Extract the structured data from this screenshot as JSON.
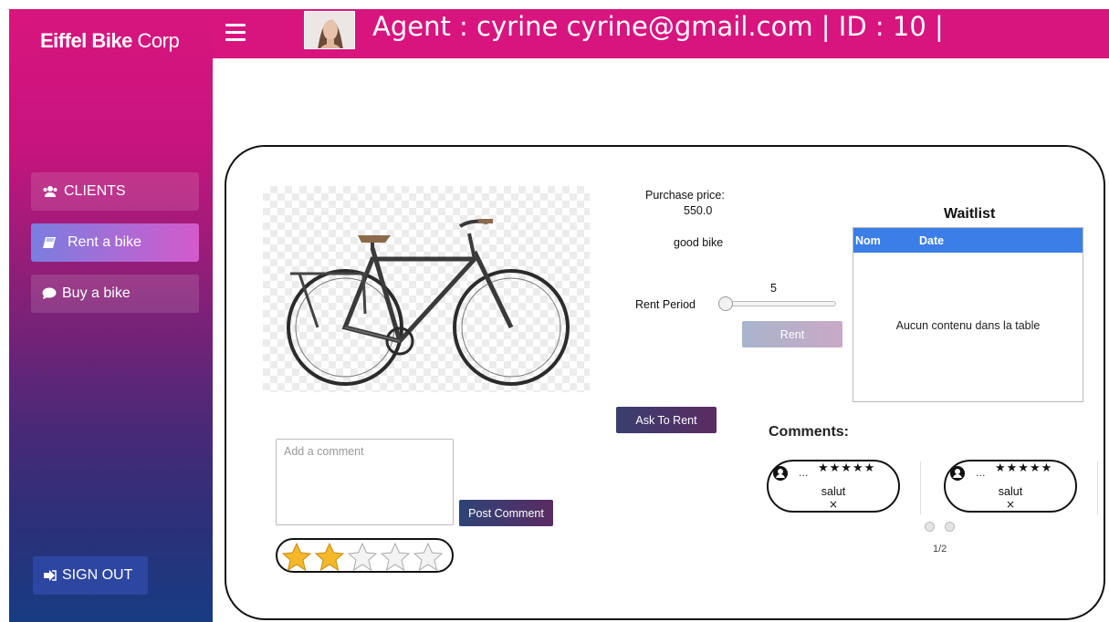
{
  "sidebar": {
    "brand": "Eiffel Bike",
    "brand_suffix": "Corp",
    "items": [
      {
        "label": "CLIENTS",
        "icon": "users-icon"
      },
      {
        "label": "Rent a bike",
        "icon": "book-icon"
      },
      {
        "label": "Buy a bike",
        "icon": "chat-icon"
      }
    ],
    "signout_label": "SIGN OUT"
  },
  "header": {
    "agent_text": "Agent : cyrine cyrine@gmail.com | ID : 10 |"
  },
  "product": {
    "purchase_label": "Purchase price:",
    "purchase_value": "550.0",
    "description": "good bike",
    "rent_period_label": "Rent Period",
    "rent_period_value": "5",
    "rent_period_level": 0.0,
    "rent_button": "Rent",
    "ask_button": "Ask To Rent"
  },
  "waitlist": {
    "title": "Waitlist",
    "columns": [
      "Nom",
      "Date"
    ],
    "empty_text": "Aucun contenu dans la table"
  },
  "comments": {
    "title": "Comments:",
    "items": [
      {
        "user": "...",
        "stars": 5,
        "text": "salut",
        "delete": "×"
      },
      {
        "user": "...",
        "stars": 5,
        "text": "salut",
        "delete": "×"
      }
    ],
    "page_indicator": "1/2"
  },
  "new_comment": {
    "placeholder": "Add a comment",
    "post_button": "Post Comment",
    "rating": 2,
    "rating_max": 5
  },
  "colors": {
    "topbar": "#d8147f",
    "table_header": "#3b7ee8",
    "star_fill": "#f5b82a"
  }
}
